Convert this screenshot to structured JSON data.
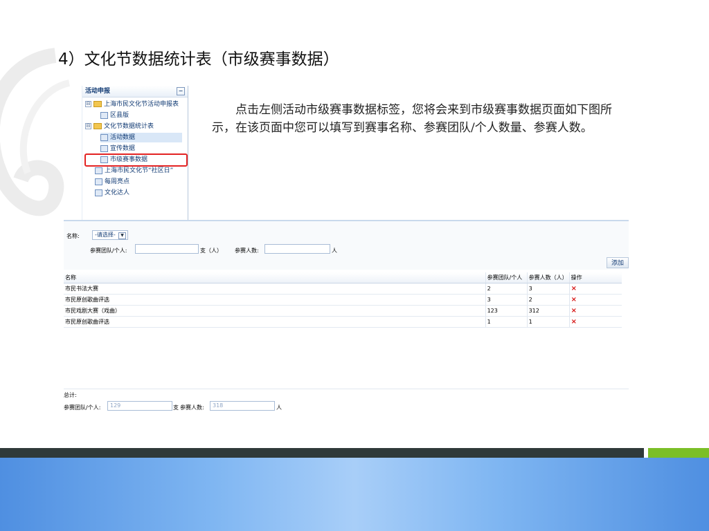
{
  "slide": {
    "title": "4）文化节数据统计表（市级赛事数据）",
    "description": "点击左侧活动市级赛事数据标签，您将会来到市级赛事数据页面如下图所示，在该页面中您可以填写到赛事名称、参赛团队/个人数量、参赛人数。"
  },
  "tree": {
    "header": "活动申报",
    "collapse_symbol": "−",
    "items": [
      {
        "label": "上海市民文化节活动申报表",
        "icon": "folder-icon",
        "toggle": "⊟"
      },
      {
        "label": "区县版",
        "icon": "page-icon"
      },
      {
        "label": "文化节数据统计表",
        "icon": "folder-icon",
        "toggle": "⊟"
      },
      {
        "label": "活动数据",
        "icon": "page-icon"
      },
      {
        "label": "宣传数据",
        "icon": "page-icon"
      },
      {
        "label": "市级赛事数据",
        "icon": "page-icon"
      },
      {
        "label": "上海市民文化节“社区日”",
        "icon": "page-icon"
      },
      {
        "label": "每周亮点",
        "icon": "page-icon"
      },
      {
        "label": "文化达人",
        "icon": "page-icon"
      }
    ]
  },
  "form": {
    "name_label": "名称:",
    "name_select": "-请选择-",
    "team_label": "参赛团队/个人:",
    "team_unit": "支（人）",
    "people_label": "参赛人数:",
    "people_unit": "人",
    "add_button": "添加"
  },
  "table": {
    "headers": [
      "名称",
      "参赛团队/个人",
      "参赛人数（人）",
      "操作"
    ],
    "rows": [
      [
        "市民书法大赛",
        "2",
        "3"
      ],
      [
        "市民原创歌曲评选",
        "3",
        "2"
      ],
      [
        "市民戏剧大赛（戏曲）",
        "123",
        "312"
      ],
      [
        "市民原创歌曲评选",
        "1",
        "1"
      ]
    ],
    "delete_symbol": "×"
  },
  "totals": {
    "label": "总计:",
    "team_label": "参赛团队/个人:",
    "team_value": "129",
    "team_unit": "支",
    "people_label": "参赛人数:",
    "people_value": "318",
    "people_unit": "人"
  },
  "colors": {
    "highlight": "#e32222",
    "delete": "#d61515",
    "accent_green": "#7bbf27"
  }
}
